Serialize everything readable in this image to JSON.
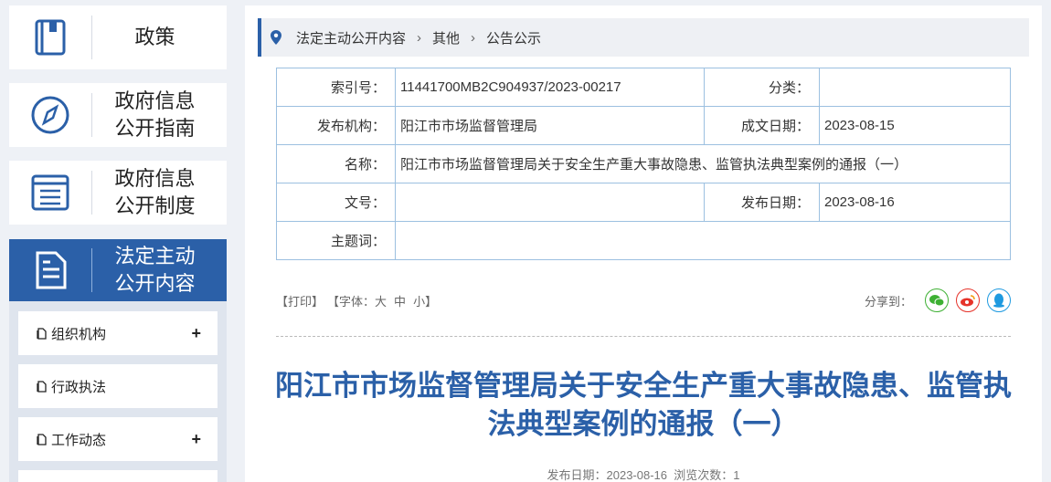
{
  "sidebar": {
    "cards": [
      {
        "label": "政策"
      },
      {
        "label": "政府信息\n公开指南"
      },
      {
        "label": "政府信息\n公开制度"
      },
      {
        "label": "法定主动\n公开内容"
      }
    ],
    "sub_items": [
      {
        "label": "组织机构",
        "expand": "+"
      },
      {
        "label": "行政执法",
        "expand": ""
      },
      {
        "label": "工作动态",
        "expand": "+"
      }
    ]
  },
  "breadcrumb": {
    "items": [
      "法定主动公开内容",
      "其他",
      "公告公示"
    ]
  },
  "meta": {
    "index_label": "索引号：",
    "index_value": "11441700MB2C904937/2023-00217",
    "category_label": "分类：",
    "category_value": "",
    "publisher_label": "发布机构：",
    "publisher_value": "阳江市市场监督管理局",
    "written_date_label": "成文日期：",
    "written_date_value": "2023-08-15",
    "name_label": "名称：",
    "name_value": "阳江市市场监督管理局关于安全生产重大事故隐患、监管执法典型案例的通报（一）",
    "doc_no_label": "文号：",
    "doc_no_value": "",
    "publish_date_label": "发布日期：",
    "publish_date_value": "2023-08-16",
    "subject_label": "主题词：",
    "subject_value": ""
  },
  "tools": {
    "print": "【打印】",
    "font_label": "【字体：",
    "large": "大",
    "medium": "中",
    "small": "小】",
    "share_label": "分享到："
  },
  "article": {
    "title": "阳江市市场监督管理局关于安全生产重大事故隐患、监管执法典型案例的通报（一）",
    "info": "发布日期：2023-08-16  浏览次数：1"
  },
  "colors": {
    "accent": "#2b60a8",
    "wechat": "#3db033",
    "weibo": "#e6332a",
    "qq": "#1e9ae0"
  }
}
